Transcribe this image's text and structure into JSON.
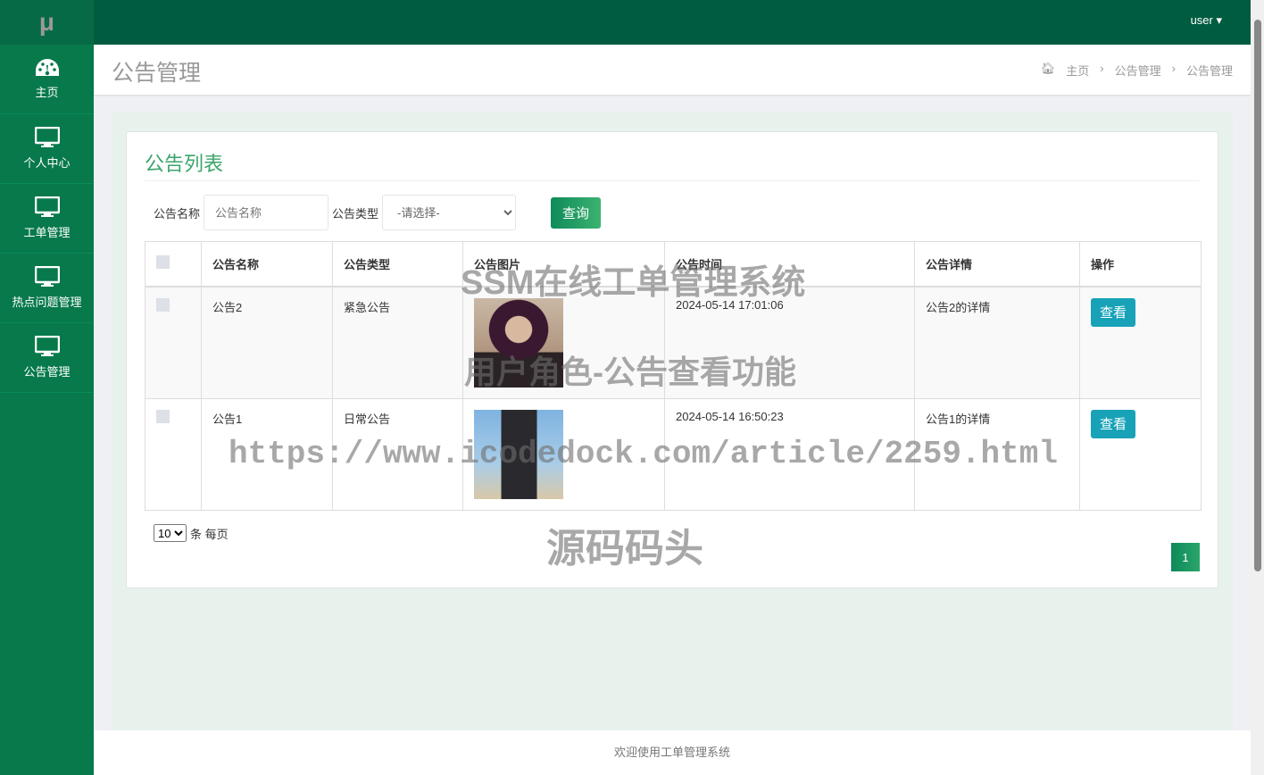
{
  "logo": "μ",
  "sidebar": {
    "items": [
      {
        "label": "主页",
        "icon": "dashboard-icon"
      },
      {
        "label": "个人中心",
        "icon": "monitor-icon"
      },
      {
        "label": "工单管理",
        "icon": "monitor-icon"
      },
      {
        "label": "热点问题管理",
        "icon": "monitor-icon"
      },
      {
        "label": "公告管理",
        "icon": "monitor-icon"
      }
    ]
  },
  "topbar": {
    "user": "user ▾"
  },
  "header": {
    "title": "公告管理",
    "breadcrumb": [
      "主页",
      "公告管理",
      "公告管理"
    ]
  },
  "card": {
    "title": "公告列表",
    "filter": {
      "name_label": "公告名称",
      "name_placeholder": "公告名称",
      "type_label": "公告类型",
      "type_selected": "-请选择-",
      "search_button": "查询"
    },
    "table": {
      "columns": [
        "公告名称",
        "公告类型",
        "公告图片",
        "公告时间",
        "公告详情",
        "操作"
      ],
      "rows": [
        {
          "name": "公告2",
          "type": "紧急公告",
          "time": "2024-05-14 17:01:06",
          "detail": "公告2的详情",
          "action": "查看"
        },
        {
          "name": "公告1",
          "type": "日常公告",
          "time": "2024-05-14 16:50:23",
          "detail": "公告1的详情",
          "action": "查看"
        }
      ]
    },
    "page_size": "10",
    "page_size_suffix": "条 每页",
    "current_page": "1"
  },
  "footer": "欢迎使用工单管理系统",
  "watermarks": [
    "SSM在线工单管理系统",
    "用户角色-公告查看功能",
    "https://www.icodedock.com/article/2259.html",
    "源码码头"
  ],
  "colors": {
    "sidebar": "#07794b",
    "topbar": "#005c40",
    "accent": "#3ca56b",
    "view_button": "#17a2b8"
  }
}
